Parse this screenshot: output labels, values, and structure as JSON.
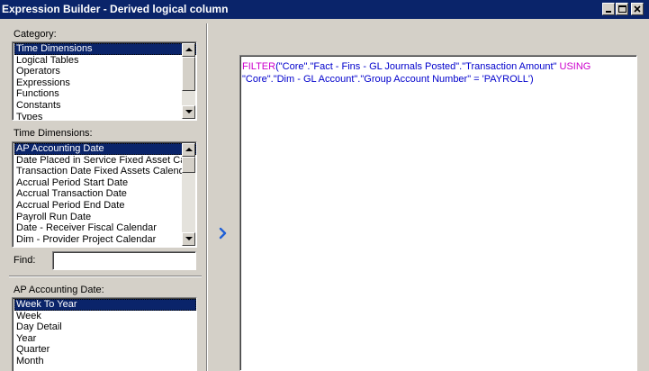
{
  "window": {
    "title": "Expression Builder - Derived logical column",
    "controls": [
      "minimize",
      "maximize",
      "close"
    ]
  },
  "category": {
    "label": "Category:",
    "items": [
      "Time Dimensions",
      "Logical Tables",
      "Operators",
      "Expressions",
      "Functions",
      "Constants",
      "Types"
    ],
    "selected_index": 0
  },
  "time_dimensions": {
    "label": "Time Dimensions:",
    "items": [
      "AP Accounting Date",
      "Date Placed in Service Fixed Asset Cale",
      "Transaction Date Fixed Assets Calendar",
      "Accrual Period Start Date",
      "Accrual Transaction Date",
      "Accrual Period End Date",
      "Payroll Run Date",
      "Date - Receiver Fiscal Calendar",
      "Dim - Provider Project Calendar"
    ],
    "selected_index": 0
  },
  "find": {
    "label": "Find:",
    "value": ""
  },
  "levels": {
    "label": "AP Accounting Date:",
    "items": [
      "Week To Year",
      "Week",
      "Day Detail",
      "Year",
      "Quarter",
      "Month"
    ],
    "selected_index": 0
  },
  "insert_button": {
    "icon": "chevron-right-icon"
  },
  "expression": {
    "part1_kw": "FILTER",
    "part2": "(\"Core\".\"Fact - Fins - GL Journals Posted\".\"Transaction Amount\" ",
    "part3_kw": "USING",
    "part4": " \"Core\".\"Dim - GL Account\".\"Group Account Number\" = 'PAYROLL')"
  },
  "colors": {
    "title_bar": "#0a246a",
    "selection": "#0a246a",
    "keyword": "#cc00cc",
    "expression_text": "#0000cc",
    "face": "#d4d0c8"
  }
}
